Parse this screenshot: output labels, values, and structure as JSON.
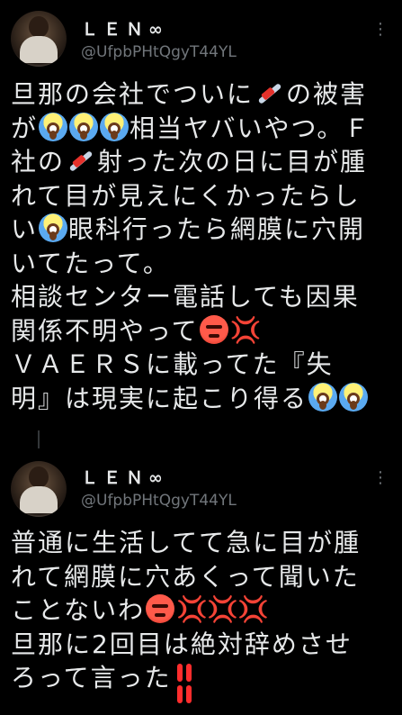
{
  "tweets": [
    {
      "name": "ＬＥＮ∞",
      "handle": "@UfpbPHtQgyT44YL",
      "more": "⋮",
      "lines": [
        [
          "旦那の会社でついに",
          {
            "emoji": "syringe"
          },
          "の被害"
        ],
        [
          "が",
          {
            "emoji": "scream"
          },
          {
            "emoji": "scream"
          },
          {
            "emoji": "scream"
          },
          "相当ヤバいやつ。Ｆ"
        ],
        [
          "社の",
          {
            "emoji": "syringe"
          },
          "射った次の日に目が腫"
        ],
        [
          "れて目が見えにくかったらし"
        ],
        [
          "い",
          {
            "emoji": "scream"
          },
          "眼科行ったら網膜に穴開"
        ],
        [
          "いてたって。"
        ],
        [
          "相談センター電話しても因果"
        ],
        [
          "関係不明やって",
          {
            "emoji": "angry"
          },
          {
            "emoji": "anger"
          }
        ],
        [
          "ＶＡＥＲＳに載ってた『失"
        ],
        [
          "明』は現実に起こり得る",
          {
            "emoji": "scream"
          },
          {
            "emoji": "scream"
          }
        ]
      ]
    },
    {
      "name": "ＬＥＮ∞",
      "handle": "@UfpbPHtQgyT44YL",
      "more": "⋮",
      "lines": [
        [
          "普通に生活してて急に目が腫"
        ],
        [
          "れて網膜に穴あくって聞いた"
        ],
        [
          "ことないわ",
          {
            "emoji": "angry"
          },
          {
            "emoji": "anger"
          },
          {
            "emoji": "anger"
          },
          {
            "emoji": "anger"
          }
        ],
        [
          "旦那に2回目は絶対辞めさせ"
        ],
        [
          "ろって言った",
          {
            "emoji": "bang"
          }
        ]
      ]
    }
  ],
  "emoji_names": {
    "syringe": "syringe-icon",
    "scream": "face-screaming-in-fear-icon",
    "angry": "angry-face-icon",
    "anger": "anger-symbol-icon",
    "bang": "double-exclamation-icon"
  }
}
